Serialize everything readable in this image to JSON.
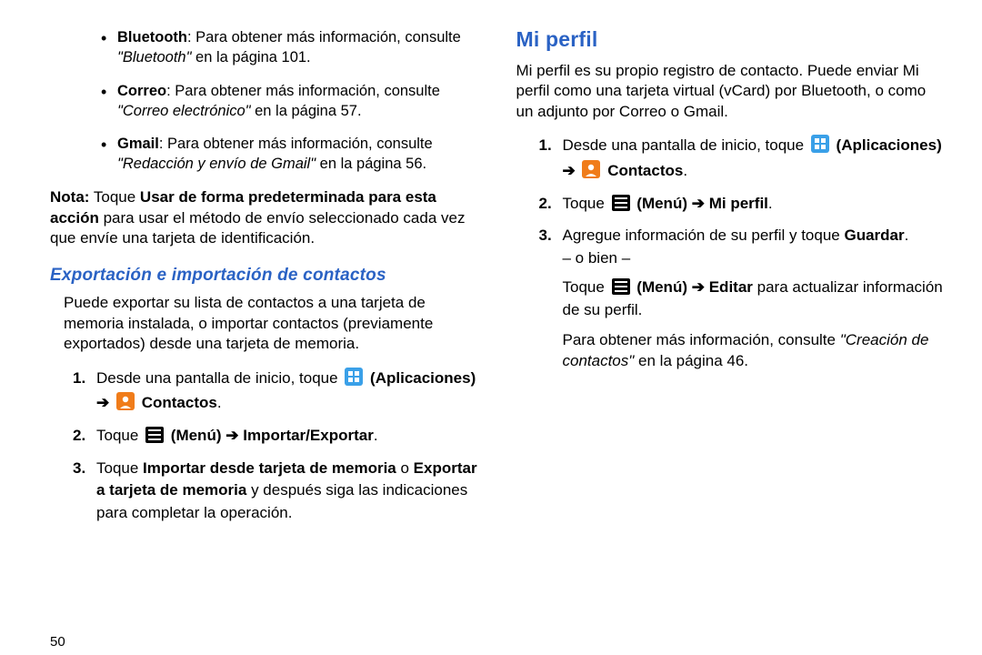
{
  "left": {
    "bullets": [
      {
        "label": "Bluetooth",
        "text_a": ": Para obtener más información, consulte ",
        "ref": "\"Bluetooth\"",
        "text_b": " en la página 101."
      },
      {
        "label": "Correo",
        "text_a": ": Para obtener más información, consulte ",
        "ref": "\"Correo electrónico\"",
        "text_b": " en la página 57."
      },
      {
        "label": "Gmail",
        "text_a": ": Para obtener más información, consulte ",
        "ref": "\"Redacción y envío de Gmail\"",
        "text_b": " en la página 56."
      }
    ],
    "nota_label": "Nota:",
    "nota_a": " Toque ",
    "nota_bold": "Usar de forma predeterminada para esta acción",
    "nota_b": " para usar el método de envío seleccionado cada vez que envíe una tarjeta de identificación.",
    "section_title": "Exportación e importación de contactos",
    "intro": "Puede exportar su lista de contactos a una tarjeta de memoria instalada, o importar contactos (previamente exportados) desde una tarjeta de memoria.",
    "steps": {
      "s1_a": "Desde una pantalla de inicio, toque ",
      "s1_apps": "(Aplicaciones)",
      "s1_arrow": "➔",
      "s1_contacts": "Contactos",
      "s1_dot": ".",
      "s2_a": "Toque ",
      "s2_menu": "(Menú)",
      "s2_arrow": "➔",
      "s2_cmd": "Importar/Exportar",
      "s2_dot": ".",
      "s3_a": "Toque ",
      "s3_b1": "Importar desde tarjeta de memoria",
      "s3_mid": " o ",
      "s3_b2": "Exportar a tarjeta de memoria",
      "s3_after": " y después siga las indicaciones para completar la operación."
    },
    "page_number": "50"
  },
  "right": {
    "title": "Mi perfil",
    "intro": "Mi perfil es su propio registro de contacto. Puede enviar Mi perfil como una tarjeta virtual (vCard) por Bluetooth, o como un adjunto por Correo o Gmail.",
    "steps": {
      "s1_a": "Desde una pantalla de inicio, toque ",
      "s1_apps": "(Aplicaciones)",
      "s1_arrow": "➔",
      "s1_contacts": "Contactos",
      "s1_dot": ".",
      "s2_a": "Toque ",
      "s2_menu": "(Menú)",
      "s2_arrow": "➔",
      "s2_cmd": "Mi perfil",
      "s2_dot": ".",
      "s3_a": "Agregue información de su perfil y toque ",
      "s3_b": "Guardar",
      "s3_dot": ".",
      "s3_alt": "– o bien –"
    },
    "cont_a": "Toque ",
    "cont_menu": "(Menú)",
    "cont_arrow": "➔",
    "cont_b": "Editar",
    "cont_after": " para actualizar información de su perfil.",
    "ref_a": "Para obtener más información, consulte ",
    "ref_i": "\"Creación de contactos\"",
    "ref_b": " en la página 46."
  }
}
